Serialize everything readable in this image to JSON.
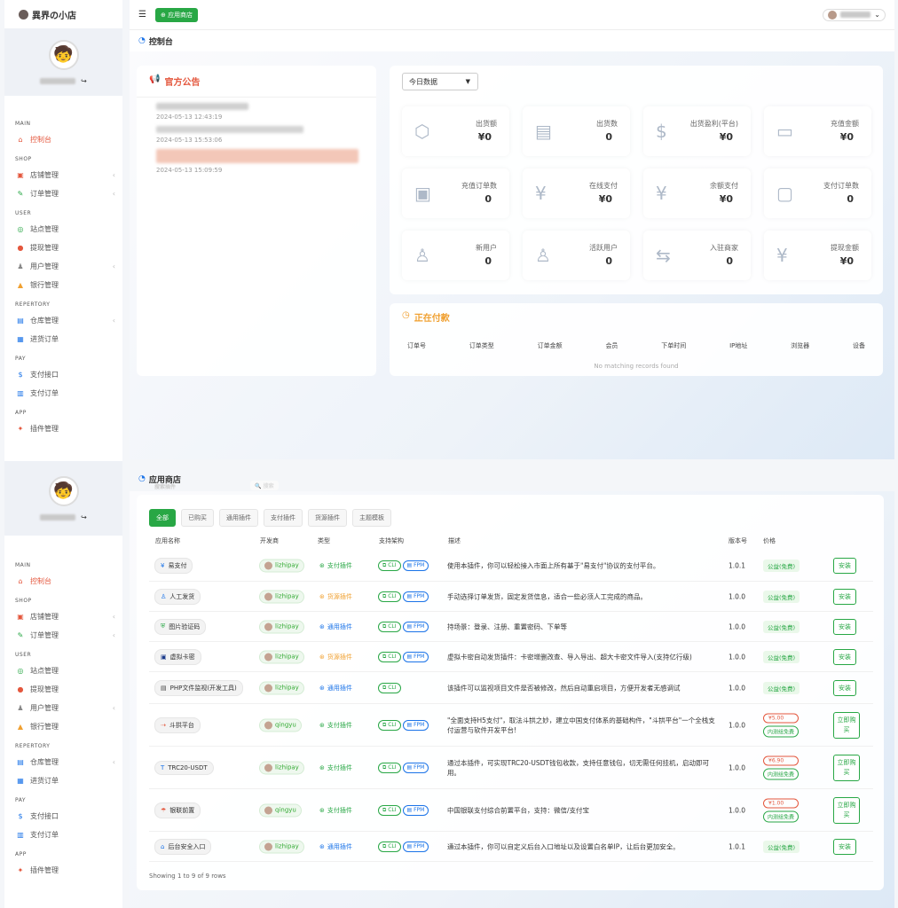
{
  "brand": "異界の小店",
  "topbar": {
    "menu_icon": "☰",
    "app_store_button": "应用商店"
  },
  "sidebar": {
    "sections": [
      {
        "title": "MAIN",
        "items": [
          {
            "label": "控制台",
            "icon": "home-icon",
            "active": true
          }
        ]
      },
      {
        "title": "SHOP",
        "items": [
          {
            "label": "店铺管理",
            "icon": "store-icon",
            "chev": true
          },
          {
            "label": "订单管理",
            "icon": "order-icon",
            "chev": true
          }
        ]
      },
      {
        "title": "USER",
        "items": [
          {
            "label": "站点管理",
            "icon": "site-icon"
          },
          {
            "label": "提现管理",
            "icon": "withdraw-icon"
          },
          {
            "label": "用户管理",
            "icon": "user-icon",
            "chev": true
          },
          {
            "label": "银行管理",
            "icon": "bank-icon"
          }
        ]
      },
      {
        "title": "REPERTORY",
        "items": [
          {
            "label": "仓库管理",
            "icon": "warehouse-icon",
            "chev": true
          },
          {
            "label": "进货订单",
            "icon": "purchase-icon"
          }
        ]
      },
      {
        "title": "PAY",
        "items": [
          {
            "label": "支付接口",
            "icon": "payment-icon"
          },
          {
            "label": "支付订单",
            "icon": "pay-order-icon"
          }
        ]
      },
      {
        "title": "APP",
        "items": [
          {
            "label": "插件管理",
            "icon": "plugin-icon"
          }
        ]
      }
    ]
  },
  "dashboard": {
    "page_title": "控制台",
    "notice_title": "官方公告",
    "notices": [
      {
        "time": "2024-05-13 12:43:19"
      },
      {
        "time": "2024-05-13 15:53:06"
      },
      {
        "time": "2024-05-13 15:09:59"
      }
    ],
    "range_select": "今日数据",
    "stats": [
      {
        "label": "出货额",
        "value": "¥0",
        "icon": "box-icon"
      },
      {
        "label": "出货数",
        "value": "0",
        "icon": "list-icon"
      },
      {
        "label": "出货盈利(平台)",
        "value": "¥0",
        "icon": "profit-icon"
      },
      {
        "label": "充值金额",
        "value": "¥0",
        "icon": "card-icon"
      },
      {
        "label": "充值订单数",
        "value": "0",
        "icon": "recharge-order-icon"
      },
      {
        "label": "在线支付",
        "value": "¥0",
        "icon": "online-pay-icon"
      },
      {
        "label": "余额支付",
        "value": "¥0",
        "icon": "balance-icon"
      },
      {
        "label": "支付订单数",
        "value": "0",
        "icon": "pay-count-icon"
      },
      {
        "label": "新用户",
        "value": "0",
        "icon": "new-user-icon"
      },
      {
        "label": "活跃用户",
        "value": "0",
        "icon": "active-user-icon"
      },
      {
        "label": "入驻商家",
        "value": "0",
        "icon": "merchant-icon"
      },
      {
        "label": "提现金额",
        "value": "¥0",
        "icon": "withdraw-amount-icon"
      }
    ],
    "paying_title": "正在付款",
    "paying_columns": [
      "订单号",
      "订单类型",
      "订单金额",
      "会员",
      "下单时间",
      "IP地址",
      "浏览器",
      "设备"
    ],
    "empty_text": "No matching records found"
  },
  "store": {
    "page_title": "应用商店",
    "search_placeholder": "搜索插件",
    "search_btn": "搜索",
    "filters": [
      "全部",
      "已购买",
      "通用插件",
      "支付插件",
      "货源插件",
      "主题模板"
    ],
    "columns": [
      "应用名称",
      "开发商",
      "类型",
      "支持架构",
      "描述",
      "版本号",
      "价格"
    ],
    "rows": [
      {
        "name": "易支付",
        "icon": "yipay-icon",
        "dev": "lizhipay",
        "type": "支付插件",
        "type_color": "#28a745",
        "cli": true,
        "fpm": true,
        "desc": "使用本插件，你可以轻松接入市面上所有基于\"易支付\"协议的支付平台。",
        "ver": "1.0.1",
        "price": "公益(免费)",
        "action": "安装"
      },
      {
        "name": "人工发货",
        "icon": "person-icon",
        "dev": "lizhipay",
        "type": "货源插件",
        "type_color": "#f0a030",
        "cli": true,
        "fpm": true,
        "desc": "手动选择订单发货，固定发货信息，适合一些必须人工完成的商品。",
        "ver": "1.0.0",
        "price": "公益(免费)",
        "action": "安装"
      },
      {
        "name": "图片验证码",
        "icon": "shield-icon",
        "dev": "lizhipay",
        "type": "通用插件",
        "type_color": "#1a73e8",
        "cli": true,
        "fpm": true,
        "desc": "持场景：登录、注册、重置密码、下单等",
        "ver": "1.0.0",
        "price": "公益(免费)",
        "action": "安装"
      },
      {
        "name": "虚拟卡密",
        "icon": "card-key-icon",
        "dev": "lizhipay",
        "type": "货源插件",
        "type_color": "#f0a030",
        "cli": true,
        "fpm": true,
        "desc": "虚拟卡密自动发货插件：卡密增删改查、导入导出、超大卡密文件导入(支持亿行级)",
        "ver": "1.0.0",
        "price": "公益(免费)",
        "action": "安装"
      },
      {
        "name": "PHP文件监视(开发工具)",
        "icon": "php-icon",
        "dev": "lizhipay",
        "type": "通用插件",
        "type_color": "#1a73e8",
        "cli": true,
        "fpm": false,
        "desc": "该插件可以监视项目文件是否被修改，然后自动重启项目，方便开发者无感调试",
        "ver": "1.0.0",
        "price": "公益(免费)",
        "action": "安装"
      },
      {
        "name": "斗拱平台",
        "icon": "dougong-icon",
        "dev": "qingyu",
        "type": "支付插件",
        "type_color": "#28a745",
        "cli": true,
        "fpm": true,
        "desc": "\"全面支持H5支付\"，取法斗拱之妙，建立中国支付体系的基础构件，\"斗拱平台\"一个全栈支付运营与软件开发平台!",
        "ver": "1.0.0",
        "price": "¥5.00",
        "trial": "内测组免费",
        "action": "立即购买"
      },
      {
        "name": "TRC20-USDT",
        "icon": "tron-icon",
        "dev": "lizhipay",
        "type": "支付插件",
        "type_color": "#28a745",
        "cli": true,
        "fpm": true,
        "desc": "通过本插件，可实现TRC20-USDT钱包收款，支持任意钱包，切无需任何挂机，启动即可用。",
        "ver": "1.0.0",
        "price": "¥6.90",
        "trial": "内测组免费",
        "action": "立即购买"
      },
      {
        "name": "银联前置",
        "icon": "unionpay-icon",
        "dev": "qingyu",
        "type": "支付插件",
        "type_color": "#28a745",
        "cli": true,
        "fpm": true,
        "desc": "中国银联支付综合前置平台，支持：微信/支付宝",
        "ver": "1.0.0",
        "price": "¥1.00",
        "trial": "内测组免费",
        "action": "立即购买"
      },
      {
        "name": "后台安全入口",
        "icon": "secure-entry-icon",
        "dev": "lizhipay",
        "type": "通用插件",
        "type_color": "#1a73e8",
        "cli": true,
        "fpm": true,
        "desc": "通过本插件，你可以自定义后台入口地址以及设置白名单IP，让后台更加安全。",
        "ver": "1.0.1",
        "price": "公益(免费)",
        "action": "安装"
      }
    ],
    "footer": "Showing 1 to 9 of 9 rows"
  }
}
